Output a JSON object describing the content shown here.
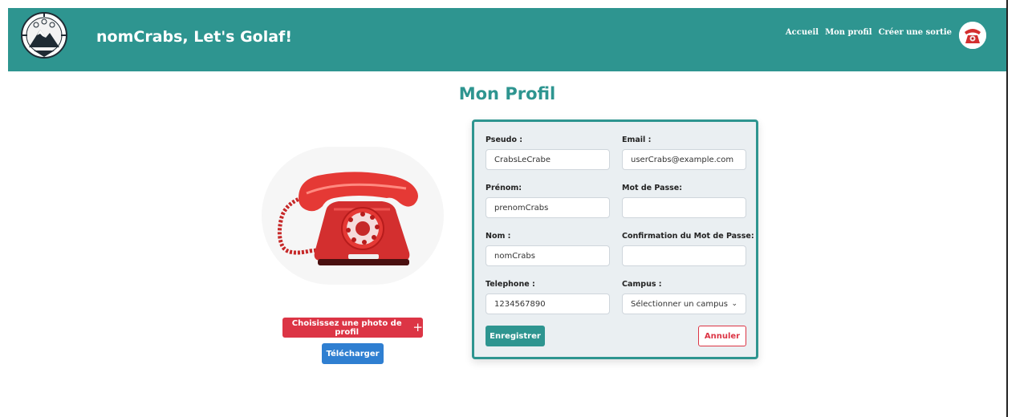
{
  "header": {
    "brand": "nomCrabs, Let's Golaf!",
    "nav": [
      "Accueil",
      "Mon profil",
      "Créer une sortie"
    ],
    "color": "#2e9590"
  },
  "main": {
    "title": "Mon Profil",
    "choose_photo_label": "Choisissez une photo de profil",
    "upload_label": "Télécharger"
  },
  "form": {
    "pseudo_label": "Pseudo :",
    "pseudo_value": "CrabsLeCrabe",
    "email_label": "Email :",
    "email_value": "userCrabs@example.com",
    "prenom_label": "Prénom:",
    "prenom_value": "prenomCrabs",
    "password_label": "Mot de Passe:",
    "password_value": "",
    "nom_label": "Nom :",
    "nom_value": "nomCrabs",
    "confirm_label": "Confirmation du Mot de Passe:",
    "confirm_value": "",
    "telephone_label": "Telephone :",
    "telephone_value": "1234567890",
    "campus_label": "Campus :",
    "campus_value": "Sélectionner un campus",
    "save_label": "Enregistrer",
    "cancel_label": "Annuler"
  },
  "icons": {
    "logo": "mountain-compass-logo",
    "avatar": "red-telephone-avatar",
    "plus": "plus-icon",
    "chevron": "chevron-down-icon"
  },
  "colors": {
    "accent": "#2e9590",
    "danger": "#dc3545",
    "primary": "#2f7fd1"
  }
}
